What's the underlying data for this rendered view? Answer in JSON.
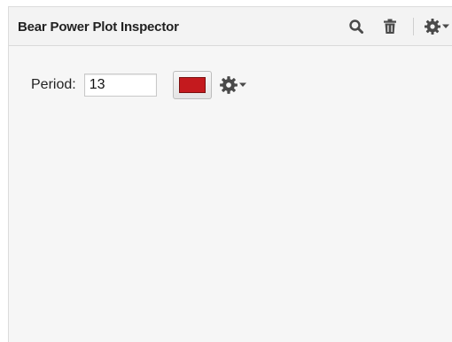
{
  "inspector": {
    "title": "Bear Power Plot Inspector",
    "header_icons": [
      "search-icon",
      "trash-icon",
      "gear-icon"
    ]
  },
  "settings": {
    "period_label": "Period:",
    "period_value": "13",
    "plot_color": "#c41a1e",
    "options_icon": "gear-icon"
  },
  "colors": {
    "icon": "#4a4a4a",
    "panel_bg": "#f6f6f6"
  }
}
